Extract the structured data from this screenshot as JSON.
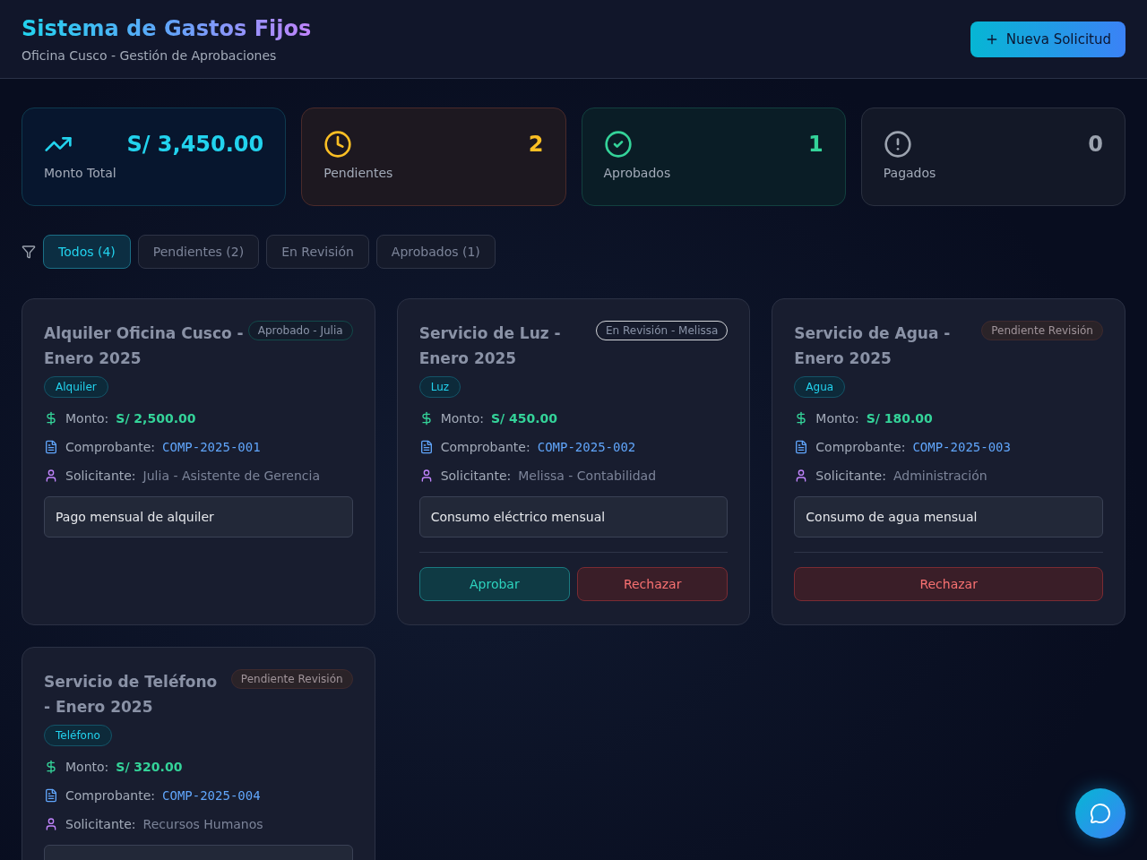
{
  "header": {
    "title": "Sistema de Gastos Fijos",
    "subtitle": "Oficina Cusco - Gestión de Aprobaciones",
    "new_button": "Nueva Solicitud"
  },
  "stats": [
    {
      "kind": "total",
      "value": "S/ 3,450.00",
      "label": "Monto Total"
    },
    {
      "kind": "pending",
      "value": "2",
      "label": "Pendientes"
    },
    {
      "kind": "approved",
      "value": "1",
      "label": "Aprobados"
    },
    {
      "kind": "paid",
      "value": "0",
      "label": "Pagados"
    }
  ],
  "filters": [
    {
      "label": "Todos (4)",
      "selected": true
    },
    {
      "label": "Pendientes (2)",
      "selected": false
    },
    {
      "label": "En Revisión",
      "selected": false
    },
    {
      "label": "Aprobados (1)",
      "selected": false
    }
  ],
  "requests": [
    {
      "title": "Alquiler Oficina Cusco - Enero 2025",
      "status": {
        "kind": "approved",
        "label": "Aprobado - Julia"
      },
      "category": "Alquiler",
      "amount_label": "Monto:",
      "amount": "S/ 2,500.00",
      "voucher_label": "Comprobante:",
      "voucher": "COMP-2025-001",
      "requester_label": "Solicitante:",
      "requester": "Julia - Asistente de Gerencia",
      "description": "Pago mensual de alquiler"
    },
    {
      "title": "Servicio de Luz - Enero 2025",
      "status": {
        "kind": "review",
        "label": "En Revisión - Melissa"
      },
      "category": "Luz",
      "amount_label": "Monto:",
      "amount": "S/ 450.00",
      "voucher_label": "Comprobante:",
      "voucher": "COMP-2025-002",
      "requester_label": "Solicitante:",
      "requester": "Melissa - Contabilidad",
      "description": "Consumo eléctrico mensual",
      "actions": [
        {
          "kind": "approve",
          "label": "Aprobar"
        },
        {
          "kind": "reject",
          "label": "Rechazar"
        }
      ]
    },
    {
      "title": "Servicio de Agua - Enero 2025",
      "status": {
        "kind": "pending",
        "label": "Pendiente Revisión"
      },
      "category": "Agua",
      "amount_label": "Monto:",
      "amount": "S/ 180.00",
      "voucher_label": "Comprobante:",
      "voucher": "COMP-2025-003",
      "requester_label": "Solicitante:",
      "requester": "Administración",
      "description": "Consumo de agua mensual",
      "actions": [
        {
          "kind": "reject",
          "label": "Rechazar"
        }
      ]
    },
    {
      "title": "Servicio de Teléfono - Enero 2025",
      "status": {
        "kind": "pending",
        "label": "Pendiente Revisión"
      },
      "category": "Teléfono",
      "amount_label": "Monto:",
      "amount": "S/ 320.00",
      "voucher_label": "Comprobante:",
      "voucher": "COMP-2025-004",
      "requester_label": "Solicitante:",
      "requester": "Recursos Humanos"
    }
  ]
}
